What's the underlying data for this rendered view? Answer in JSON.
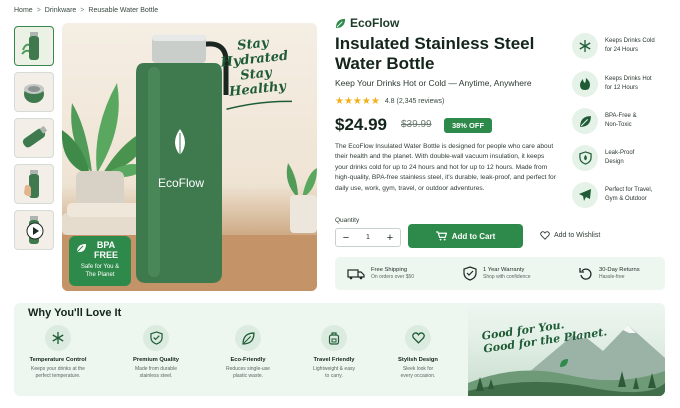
{
  "breadcrumb": {
    "items": [
      "Home",
      "Drinkware",
      "Reusable Water Bottle"
    ],
    "separator": ">"
  },
  "brand": {
    "name": "EcoFlow"
  },
  "hero": {
    "bottle_logo": "EcoFlow",
    "tagline_lines": [
      "Stay",
      "Hydrated",
      "Stay",
      "Healthy"
    ],
    "badge_line1": "BPA",
    "badge_line2": "FREE",
    "badge_line3": "Safe for You &",
    "badge_line4": "The Planet"
  },
  "product": {
    "title": "Insulated Stainless Steel Water Bottle",
    "subtitle": "Keep Your Drinks Hot or Cold — Anytime, Anywhere",
    "rating_value": 4.8,
    "rating_text": "4.8 (2,345 reviews)",
    "price": "$24.99",
    "old_price": "$39.99",
    "discount": "38% OFF",
    "description": "The EcoFlow Insulated Water Bottle is designed for people who care about their health and the planet. With double-wall vacuum insulation, it keeps your drinks cold for up to 24 hours and hot for up to 12 hours. Made from high-quality, BPA-free stainless steel, it's durable, leak-proof, and perfect for daily use, work, gym, travel, or outdoor adventures."
  },
  "purchase": {
    "quantity_label": "Quantity",
    "quantity_value": "1",
    "minus_label": "−",
    "plus_label": "+",
    "add_to_cart": "Add to Cart",
    "wishlist": "Add to Wishlist"
  },
  "shipping": [
    {
      "icon": "truck-icon",
      "title": "Free Shipping",
      "detail": "On orders over $50"
    },
    {
      "icon": "shield-check-icon",
      "title": "1 Year Warranty",
      "detail": "Shop with confidence"
    },
    {
      "icon": "return-icon",
      "title": "30-Day Returns",
      "detail": "Hassle-free"
    }
  ],
  "features": [
    {
      "icon": "snowflake-icon",
      "line1": "Keeps Drinks Cold",
      "line2": "for 24 Hours"
    },
    {
      "icon": "flame-icon",
      "line1": "Keeps Drinks Hot",
      "line2": "for 12 Hours"
    },
    {
      "icon": "leaf-icon",
      "line1": "BPA-Free &",
      "line2": "Non-Toxic"
    },
    {
      "icon": "shield-drop-icon",
      "line1": "Leak-Proof",
      "line2": "Design"
    },
    {
      "icon": "plane-icon",
      "line1": "Perfect for Travel,",
      "line2": "Gym & Outdoor"
    }
  ],
  "why": {
    "title": "Why You'll Love It",
    "items": [
      {
        "icon": "snowflake-icon",
        "title": "Temperature Control",
        "line1": "Keeps your drinks at the",
        "line2": "perfect temperature."
      },
      {
        "icon": "shield-check-icon",
        "title": "Premium Quality",
        "line1": "Made from durable",
        "line2": "stainless steel."
      },
      {
        "icon": "leaf-icon",
        "title": "Eco-Friendly",
        "line1": "Reduces single-use",
        "line2": "plastic waste."
      },
      {
        "icon": "backpack-icon",
        "title": "Travel Friendly",
        "line1": "Lightweight & easy",
        "line2": "to carry."
      },
      {
        "icon": "heart-icon",
        "title": "Stylish Design",
        "line1": "Sleek look for",
        "line2": "every occasion."
      }
    ],
    "slogan_line1": "Good for You.",
    "slogan_line2": "Good for the Planet."
  },
  "colors": {
    "brand_green": "#2e8a4a",
    "bottle_green": "#3f7a4e",
    "star": "#f2b01e",
    "panel": "#eef6f0"
  }
}
